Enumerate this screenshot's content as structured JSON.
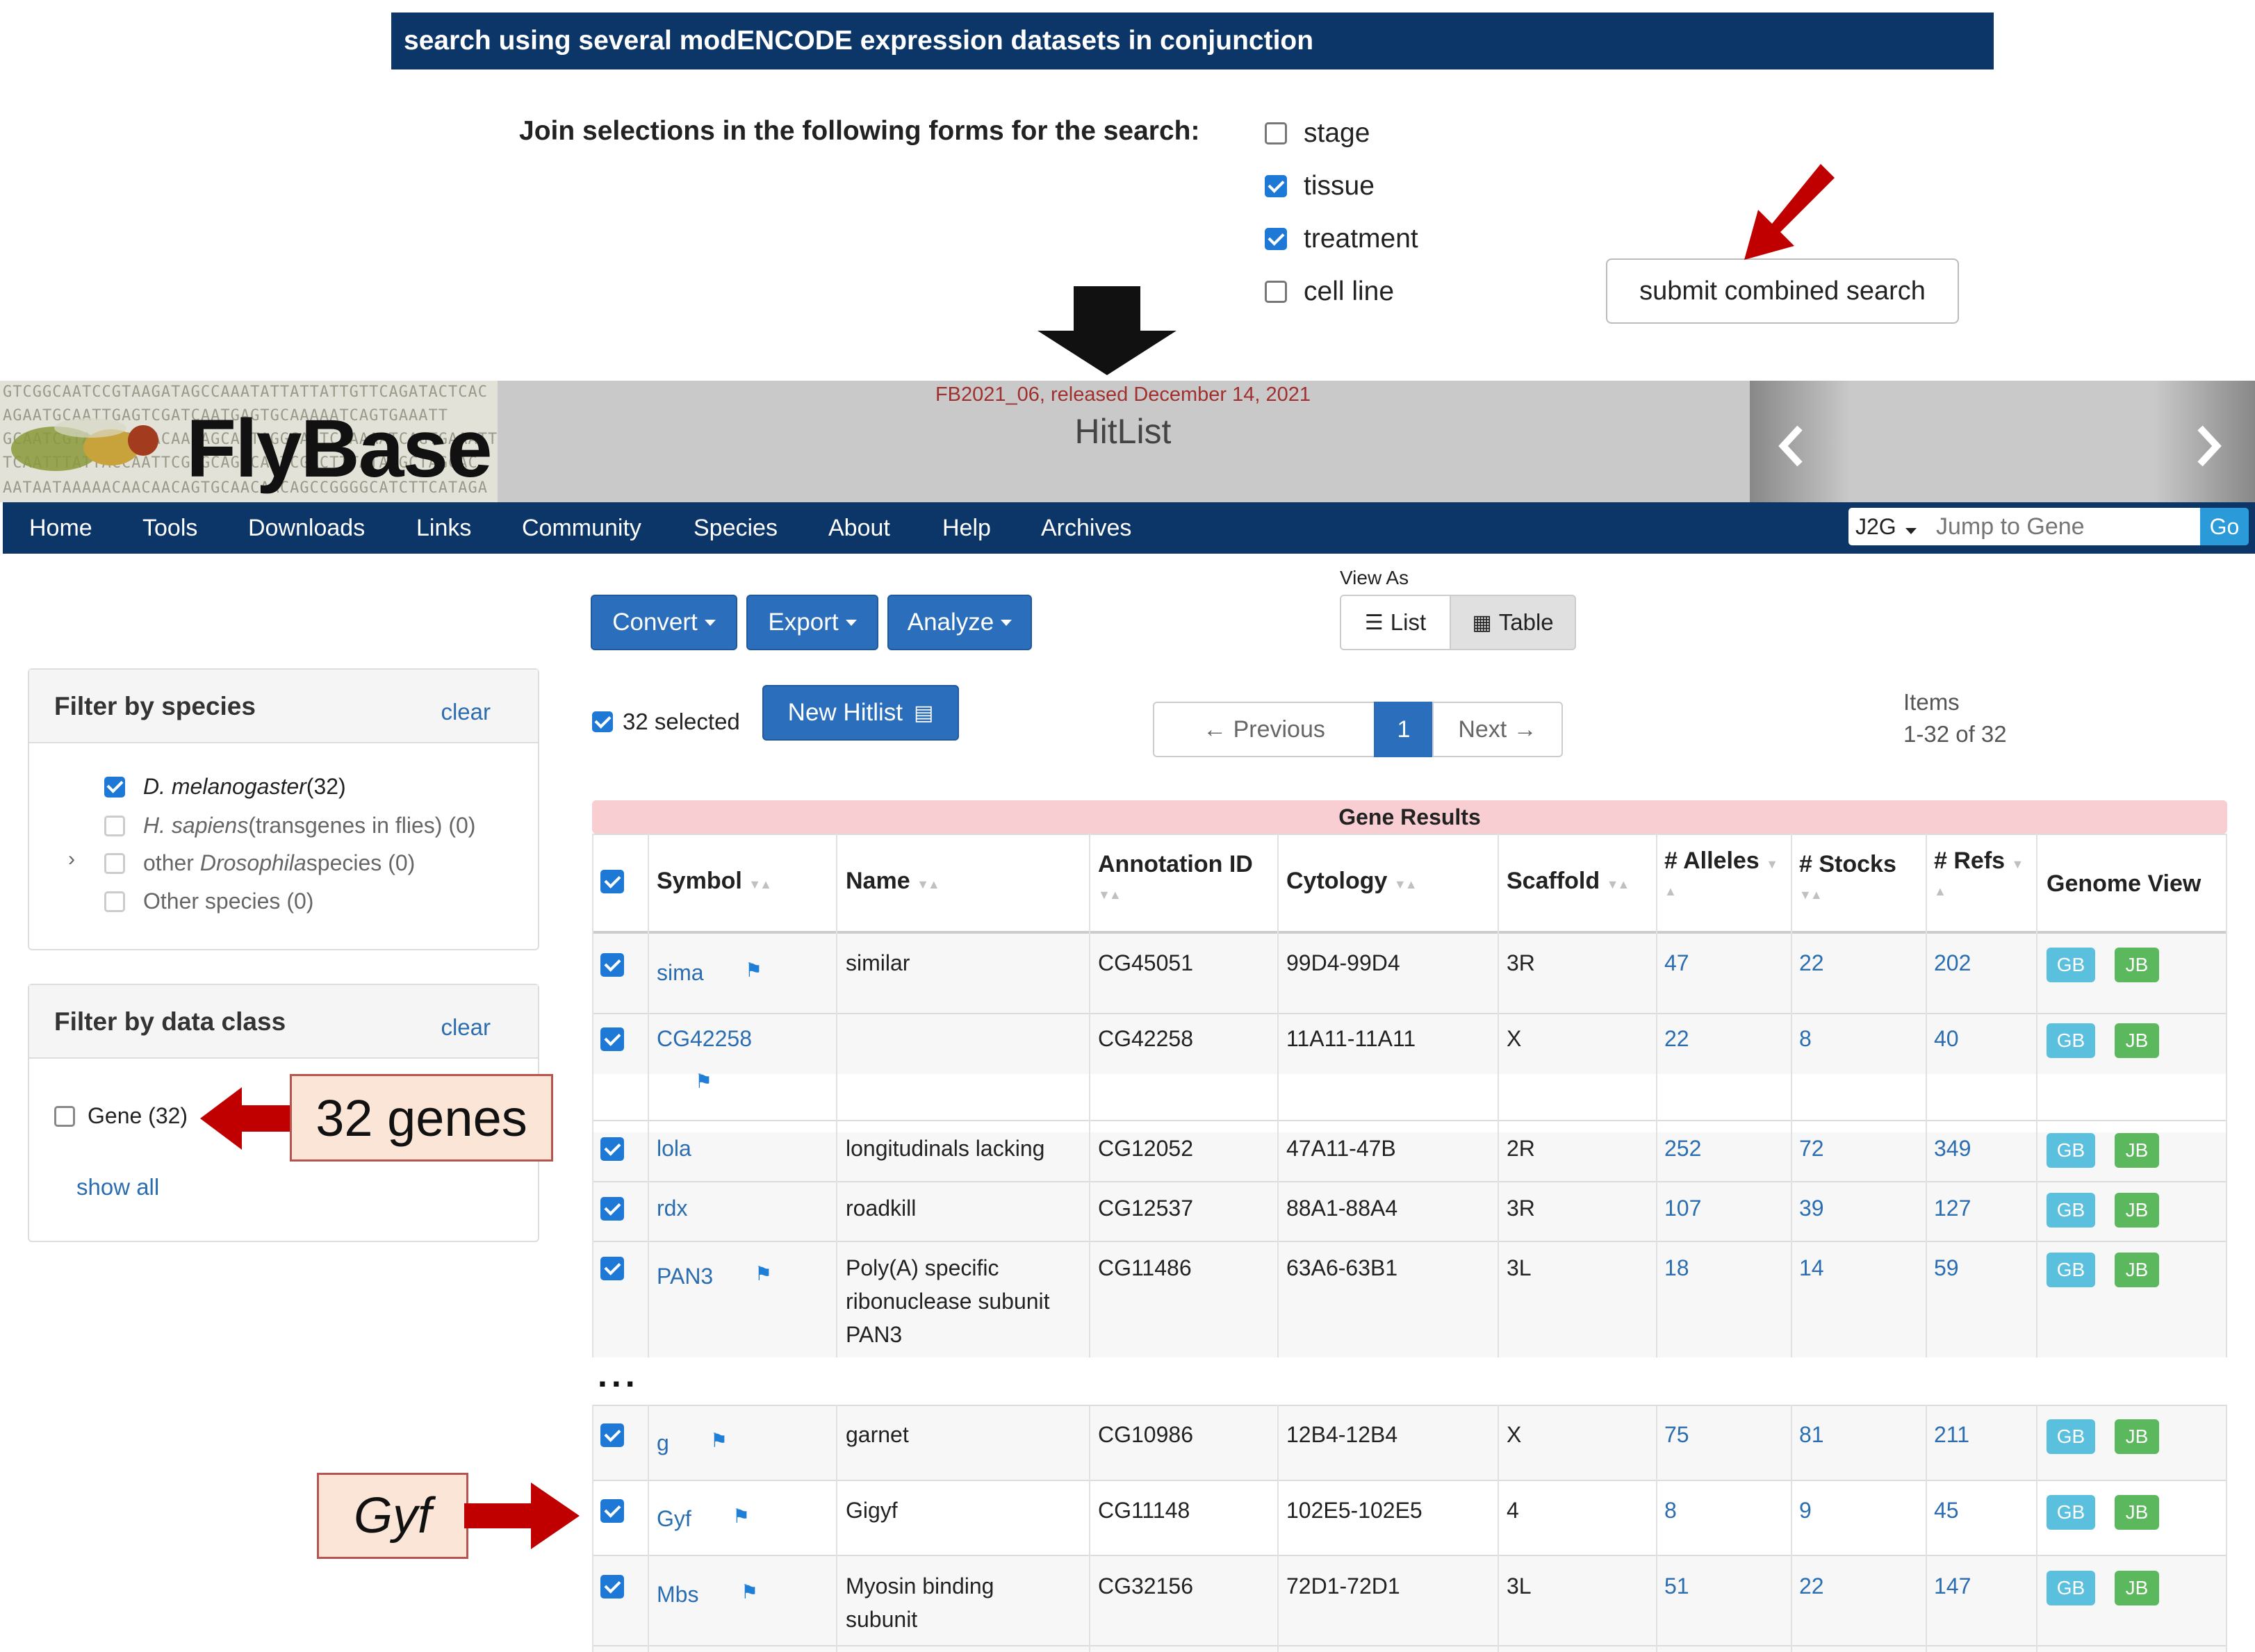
{
  "modencode": {
    "bar_title": "search using several modENCODE expression datasets in conjunction",
    "join_label": "Join selections in the following forms for the search:",
    "options": [
      {
        "label": "stage",
        "checked": false
      },
      {
        "label": "tissue",
        "checked": true
      },
      {
        "label": "treatment",
        "checked": true
      },
      {
        "label": "cell line",
        "checked": false
      }
    ],
    "submit_label": "submit combined search"
  },
  "header": {
    "logo_text": "FlyBase",
    "release": "FB2021_06, released December 14, 2021",
    "page_title": "HitList",
    "seq_lines": [
      "GTCGGCAATCCGTAAGATAGCCAAATATTATTATTGTTCAGATACTCAC",
      "AGAATGCAATTGAGTCGATCAATGAGTGCAAAAATCAGTGAAATT",
      "GCAATCGTAATACTAACAACAGCAATAGGCAGTCAAAAATCAGTGAAATT",
      "TCAATTTATTACCAATTCGCGCAGTCAATCGACTTTATAGGCTAGCAC",
      "AATAATAAAAACAACAACAGTGCAACAACAGCCGGGGCATCTTCATAGA"
    ]
  },
  "nav": {
    "items": [
      "Home",
      "Tools",
      "Downloads",
      "Links",
      "Community",
      "Species",
      "About",
      "Help",
      "Archives"
    ],
    "j2g_label": "J2G",
    "jump_placeholder": "Jump to Gene",
    "go_label": "Go"
  },
  "filters": {
    "species_title": "Filter by species",
    "clear_label": "clear",
    "species": [
      {
        "name": "D. melanogaster",
        "rest": " (32)",
        "checked": true,
        "dim": false
      },
      {
        "name": "H. sapiens",
        "rest": " (transgenes in flies) (0)",
        "checked": false,
        "dim": true
      },
      {
        "pre": "other ",
        "name": "Drosophila",
        "rest": " species (0)",
        "checked": false,
        "dim": true
      },
      {
        "pre": "Other species (0)",
        "name": "",
        "rest": "",
        "checked": false,
        "dim": true
      }
    ],
    "dataclass_title": "Filter by data class",
    "gene_label": "Gene (32)",
    "show_all": "show all"
  },
  "toolbar": {
    "convert": "Convert",
    "export": "Export",
    "analyze": "Analyze",
    "view_as": "View As",
    "list": "List",
    "table": "Table",
    "selected": "32 selected",
    "new_hitlist": "New Hitlist",
    "previous": "← Previous",
    "page": "1",
    "next": "Next →",
    "items_label": "Items",
    "items_range": "1-32 of 32"
  },
  "table": {
    "section_title": "Gene Results",
    "columns": [
      "Symbol",
      "Name",
      "Annotation ID",
      "Cytology",
      "Scaffold",
      "# Alleles",
      "# Stocks",
      "# Refs",
      "Genome View"
    ],
    "rows": [
      {
        "symbol": "sima",
        "name": "similar",
        "id": "CG45051",
        "cyto": "99D4-99D4",
        "scaffold": "3R",
        "alleles": "47",
        "stocks": "22",
        "refs": "202"
      },
      {
        "symbol": "CG42258",
        "name": "",
        "id": "CG42258",
        "cyto": "11A11-11A11",
        "scaffold": "X",
        "alleles": "22",
        "stocks": "8",
        "refs": "40"
      },
      {
        "symbol": "lola",
        "name": "longitudinals lacking",
        "id": "CG12052",
        "cyto": "47A11-47B",
        "scaffold": "2R",
        "alleles": "252",
        "stocks": "72",
        "refs": "349"
      },
      {
        "symbol": "rdx",
        "name": "roadkill",
        "id": "CG12537",
        "cyto": "88A1-88A4",
        "scaffold": "3R",
        "alleles": "107",
        "stocks": "39",
        "refs": "127"
      },
      {
        "symbol": "PAN3",
        "name": "Poly(A) specific ribonuclease subunit PAN3",
        "id": "CG11486",
        "cyto": "63A6-63B1",
        "scaffold": "3L",
        "alleles": "18",
        "stocks": "14",
        "refs": "59"
      },
      {
        "symbol": "g",
        "name": "garnet",
        "id": "CG10986",
        "cyto": "12B4-12B4",
        "scaffold": "X",
        "alleles": "75",
        "stocks": "81",
        "refs": "211"
      },
      {
        "symbol": "Gyf",
        "name": "Gigyf",
        "id": "CG11148",
        "cyto": "102E5-102E5",
        "scaffold": "4",
        "alleles": "8",
        "stocks": "9",
        "refs": "45"
      },
      {
        "symbol": "Mbs",
        "name": "Myosin binding subunit",
        "id": "CG32156",
        "cyto": "72D1-72D1",
        "scaffold": "3L",
        "alleles": "51",
        "stocks": "22",
        "refs": "147"
      }
    ],
    "gb": "GB",
    "jb": "JB",
    "ellipsis": "..."
  },
  "annotations": {
    "genes_callout": "32 genes",
    "gyf_callout": "Gyf"
  },
  "colors": {
    "nav": "#0d3668",
    "primary": "#2a6ebc",
    "link": "#2a6db0",
    "gb": "#5bc0de",
    "jb": "#5cb85c",
    "arrow": "#c00000",
    "callout": "#fbe5d6"
  }
}
